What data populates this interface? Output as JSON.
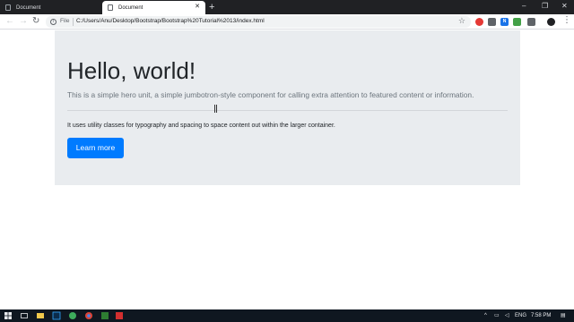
{
  "browser": {
    "tabs": [
      {
        "title": "Document",
        "active": false
      },
      {
        "title": "Document",
        "active": true
      }
    ],
    "new_tab_glyph": "+",
    "window_controls": {
      "minimize": "–",
      "maximize": "❐",
      "close": "✕"
    },
    "nav": {
      "back": "←",
      "forward": "→",
      "reload": "↻"
    },
    "address": {
      "scheme_label": "File",
      "url": "C:/Users/Anu/Desktop/Bootstrap/Bootstrap%20Tutorial%2013/index.html"
    },
    "extensions": [
      {
        "icon": "record-extension-icon",
        "color": "#e53935"
      },
      {
        "icon": "calendar-extension-icon",
        "color": "#5f6368"
      },
      {
        "icon": "n-extension-icon",
        "color": "#1a73e8",
        "text": "N"
      },
      {
        "icon": "screenshot-extension-icon",
        "color": "#43a047"
      },
      {
        "icon": "menu-extension-icon",
        "color": "#5f6368"
      },
      {
        "icon": "crop-extension-icon",
        "color": "#5f6368"
      }
    ]
  },
  "jumbotron": {
    "title": "Hello, world!",
    "lead": "This is a simple hero unit, a simple jumbotron-style component for calling extra attention to featured content or information.",
    "body": "It uses utility classes for typography and spacing to space content out within the larger container.",
    "button_label": "Learn more",
    "bg_color": "#e9ecef",
    "button_color": "#007bff"
  },
  "taskbar": {
    "language": "ENG",
    "time": "7:58 PM"
  }
}
